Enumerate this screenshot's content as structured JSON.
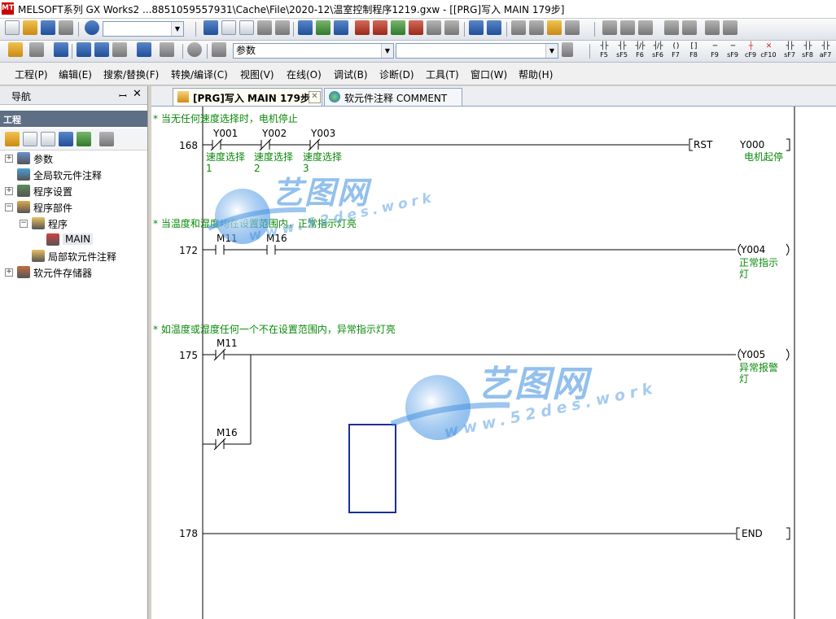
{
  "window": {
    "title": "MELSOFT系列 GX Works2 ...8851059557931\\Cache\\File\\2020-12\\温室控制程序1219.gxw - [[PRG]写入 MAIN 179步]",
    "icon_text": "MT"
  },
  "toolbar": {
    "combo1_value": "",
    "combo2_value": "参数",
    "combo3_value": "",
    "fkeys": [
      {
        "glyph": "┤├",
        "label": "F5"
      },
      {
        "glyph": "┤├",
        "label": "sF5"
      },
      {
        "glyph": "┤/├",
        "label": "F6"
      },
      {
        "glyph": "┤/├",
        "label": "sF6"
      },
      {
        "glyph": "( )",
        "label": "F7"
      },
      {
        "glyph": "[ ]",
        "label": "F8"
      },
      {
        "glyph": "─",
        "label": "F9"
      },
      {
        "glyph": "─",
        "label": "sF9"
      },
      {
        "glyph": "┼",
        "label": "cF9"
      },
      {
        "glyph": "✕",
        "label": "cF10"
      },
      {
        "glyph": "┤├",
        "label": "sF7"
      },
      {
        "glyph": "┤├",
        "label": "sF8"
      },
      {
        "glyph": "┤├",
        "label": "aF7"
      }
    ]
  },
  "menu": [
    "工程(P)",
    "编辑(E)",
    "搜索/替换(F)",
    "转换/编译(C)",
    "视图(V)",
    "在线(O)",
    "调试(B)",
    "诊断(D)",
    "工具(T)",
    "窗口(W)",
    "帮助(H)"
  ],
  "nav": {
    "title": "导航",
    "pin": "ꟷ",
    "close": "✕",
    "project_header": "工程",
    "tree": [
      {
        "label": "参数",
        "pm": "+"
      },
      {
        "label": "全局软元件注释",
        "pm": ""
      },
      {
        "label": "程序设置",
        "pm": "+"
      },
      {
        "label": "程序部件",
        "pm": "−"
      },
      {
        "label": "程序",
        "pm": "−"
      },
      {
        "label": "MAIN",
        "pm": ""
      },
      {
        "label": "局部软元件注释",
        "pm": ""
      },
      {
        "label": "软元件存储器",
        "pm": "+"
      }
    ]
  },
  "tabs": [
    {
      "label": "[PRG]写入 MAIN 179步",
      "active": true
    },
    {
      "label": "软元件注释 COMMENT",
      "active": false
    }
  ],
  "ladder": {
    "rungs": [
      {
        "comment": "* 当无任何速度选择时，电机停止",
        "step": "168",
        "contacts": [
          {
            "device": "Y001",
            "type": "nc",
            "comment": "速度选择\n1"
          },
          {
            "device": "Y002",
            "type": "nc",
            "comment": "速度选择\n2"
          },
          {
            "device": "Y003",
            "type": "nc",
            "comment": "速度选择\n3"
          }
        ],
        "output": {
          "instr": "RST",
          "device": "Y000",
          "comment": "电机起停"
        }
      },
      {
        "comment": "* 当温度和湿度均在设置范围内，正常指示灯亮",
        "step": "172",
        "contacts": [
          {
            "device": "M11",
            "type": "no"
          },
          {
            "device": "M16",
            "type": "no"
          }
        ],
        "output": {
          "device": "Y004",
          "comment": "正常指示\n灯"
        }
      },
      {
        "comment": "* 如温度或湿度任何一个不在设置范围内，异常指示灯亮",
        "step": "175",
        "contacts": [
          {
            "device": "M11",
            "type": "nc"
          },
          {
            "device": "M16",
            "type": "nc"
          }
        ],
        "output": {
          "device": "Y005",
          "comment": "异常报警\n灯"
        }
      },
      {
        "step": "178",
        "output": {
          "device": "END"
        }
      }
    ]
  },
  "watermark": {
    "brand": "艺图网",
    "url": "www.52des.work"
  },
  "colors": {
    "comment_green": "#0a8a0a",
    "selection_blue": "#1b2f9a",
    "watermark_blue": "#3b8de0"
  }
}
